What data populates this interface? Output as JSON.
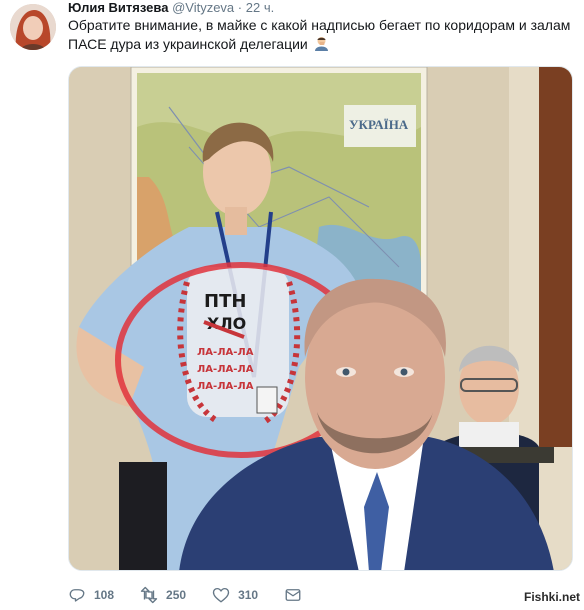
{
  "tweet": {
    "author_name": "Юлия Витязева",
    "handle": "@Vityzeva",
    "separator": "·",
    "time": "22 ч.",
    "text": "Обратите внимание, в майке с какой надписью бегает по коридорам и залам ПАСЕ дура из украинской делегации",
    "emoji": "person-facepalming-emoji"
  },
  "media": {
    "map_title": "УКРАЇНА",
    "shirt_text_top": "ПТН",
    "shirt_text_mid": "ХЛО",
    "shirt_text_rows": [
      "ЛА-ЛА-ЛА",
      "ЛА-ЛА-ЛА",
      "ЛА-ЛА-ЛА"
    ],
    "highlight_color": "#e0323c"
  },
  "actions": {
    "reply": {
      "icon": "reply-icon",
      "count": "108"
    },
    "retweet": {
      "icon": "retweet-icon",
      "count": "250"
    },
    "like": {
      "icon": "heart-icon",
      "count": "310"
    },
    "message": {
      "icon": "envelope-icon"
    }
  },
  "watermark": "Fishki.net"
}
